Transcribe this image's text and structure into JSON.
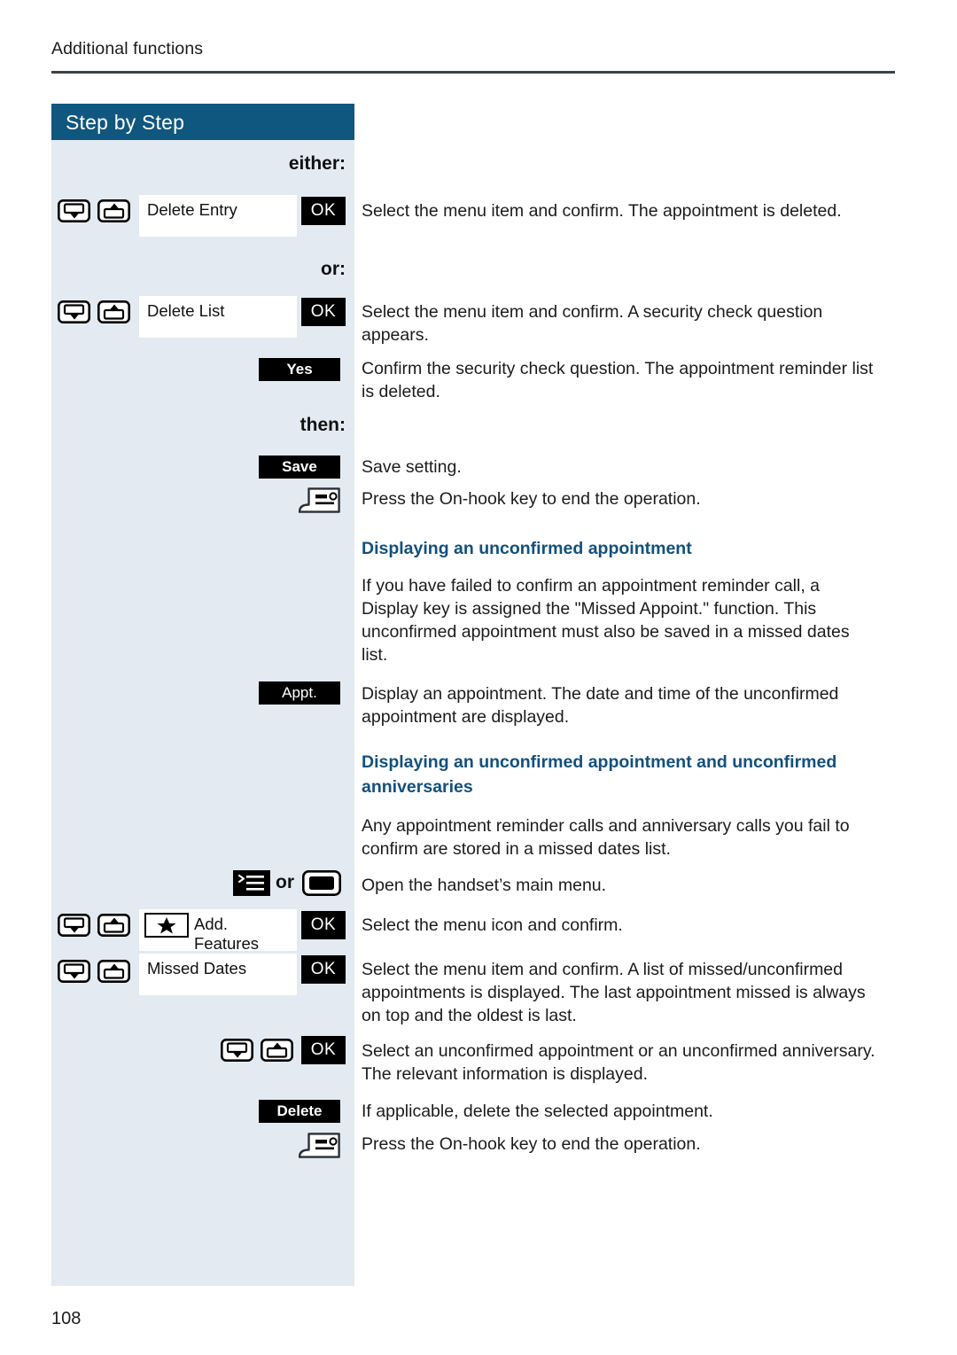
{
  "running_head": "Additional functions",
  "sidebar": {
    "title": "Step by Step",
    "keywords": {
      "either": "either:",
      "or": "or:",
      "then": "then:"
    },
    "badges": {
      "ok": "OK",
      "yes": "Yes",
      "save": "Save",
      "appt": "Appt.",
      "delete": "Delete"
    },
    "display_fields": {
      "delete_entry": "Delete Entry",
      "delete_list": "Delete List",
      "add_features": "Add. Features",
      "missed_dates": "Missed Dates"
    },
    "or_connector": "or",
    "icons": {
      "scroll_down_key": "nav-down-key-icon",
      "scroll_up_key": "nav-up-key-icon",
      "on_hook_key": "on-hook-key-icon",
      "main_menu_key": "main-menu-key-icon",
      "display_key": "display-key-icon",
      "star_key": "star-key-icon"
    }
  },
  "body": {
    "step_delete_entry": "Select the menu item and confirm. The appointment is deleted.",
    "step_delete_list": "Select the menu item and confirm. A security check question appears.",
    "step_yes": "Confirm the security check question. The appointment reminder list is deleted.",
    "step_save": "Save setting.",
    "step_on_hook_1": "Press the On-hook key to end the operation.",
    "heading_1": "Displaying an unconfirmed appointment",
    "para_1": "If you have failed to confirm an appointment reminder call, a Display key is assigned the \"Missed Appoint.\" function. This unconfirmed appointment must also be saved in a missed dates list.",
    "step_appt": "Display an appointment. The date and time of the unconfirmed appointment are displayed.",
    "heading_2": "Displaying an unconfirmed appointment and unconfirmed anniversaries",
    "para_2": "Any appointment reminder calls and anniversary calls you fail to confirm are stored in a missed dates list.",
    "step_open_menu": "Open the handset’s main menu.",
    "step_select_menu_icon": "Select the menu icon and confirm.",
    "step_missed_dates": "Select the menu item and confirm. A list of missed/unconfirmed appointments is displayed. The last appointment missed is always on top and the oldest is last.",
    "step_select_unconfirmed": "Select an unconfirmed appointment or an unconfirmed anniversary. The relevant information is displayed.",
    "step_delete": "If applicable, delete the selected appointment.",
    "step_on_hook_2": "Press the On-hook key to end the operation."
  },
  "footer": {
    "page_number": "108"
  },
  "colors": {
    "sidebar_bg": "#e3eaf1",
    "sidebar_header_bg": "#10577f",
    "heading_blue": "#13507d",
    "badge_bg": "#000000",
    "rule": "#3c4349"
  }
}
